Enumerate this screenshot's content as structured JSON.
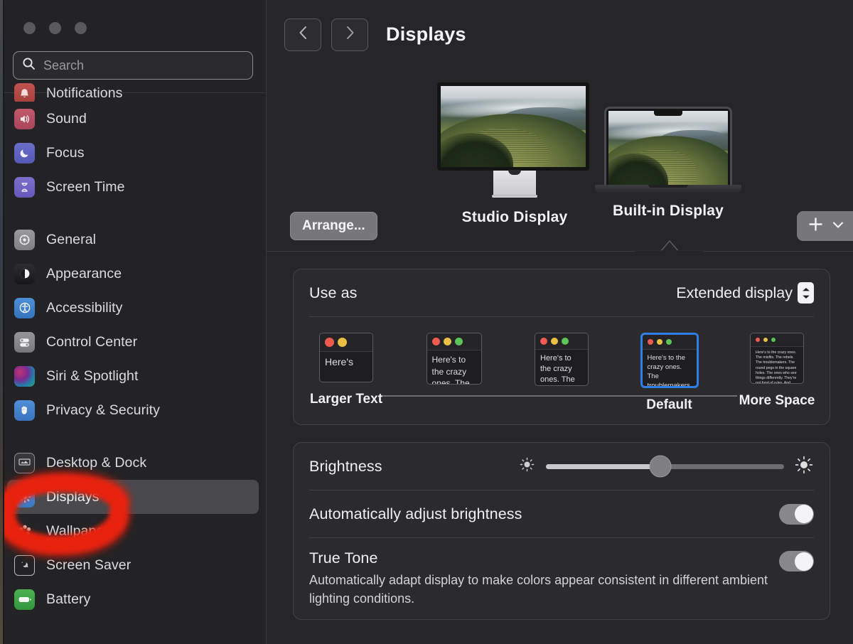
{
  "window": {
    "traffic_lights": [
      "close",
      "minimize",
      "zoom"
    ]
  },
  "search": {
    "placeholder": "Search",
    "value": "",
    "icon": "search-icon"
  },
  "sidebar": {
    "groups": [
      {
        "items": [
          {
            "label": "Notifications",
            "icon": "notifications-icon",
            "clipped": true
          },
          {
            "label": "Sound",
            "icon": "sound-icon"
          },
          {
            "label": "Focus",
            "icon": "focus-icon"
          },
          {
            "label": "Screen Time",
            "icon": "screen-time-icon"
          }
        ]
      },
      {
        "items": [
          {
            "label": "General",
            "icon": "general-icon"
          },
          {
            "label": "Appearance",
            "icon": "appearance-icon"
          },
          {
            "label": "Accessibility",
            "icon": "accessibility-icon"
          },
          {
            "label": "Control Center",
            "icon": "control-center-icon"
          },
          {
            "label": "Siri & Spotlight",
            "icon": "siri-icon"
          },
          {
            "label": "Privacy & Security",
            "icon": "privacy-icon"
          }
        ]
      },
      {
        "items": [
          {
            "label": "Desktop & Dock",
            "icon": "desktop-dock-icon"
          },
          {
            "label": "Displays",
            "icon": "displays-icon",
            "selected": true
          },
          {
            "label": "Wallpaper",
            "icon": "wallpaper-icon"
          },
          {
            "label": "Screen Saver",
            "icon": "screen-saver-icon"
          },
          {
            "label": "Battery",
            "icon": "battery-icon"
          }
        ]
      }
    ]
  },
  "annotation": {
    "shape": "hand-drawn-ellipse",
    "color": "#e02214",
    "targets": "Displays"
  },
  "toolbar": {
    "back_icon": "chevron-left-icon",
    "forward_icon": "chevron-right-icon",
    "title": "Displays"
  },
  "display_picker": {
    "arrange_label": "Arrange...",
    "add_icon": "plus-icon",
    "add_chevron_icon": "chevron-down-icon",
    "displays": [
      {
        "name": "Studio Display",
        "type": "monitor",
        "selected": false
      },
      {
        "name": "Built-in Display",
        "type": "laptop",
        "selected": true
      }
    ]
  },
  "resolution_panel": {
    "use_as_label": "Use as",
    "use_as_value": "Extended display",
    "use_as_stepper_icon": "chevron-up-down-icon",
    "options": [
      {
        "caption": "Larger Text",
        "text": "Here's",
        "selected": false,
        "thumb_w": 76,
        "thumb_h": 70,
        "font_size": 14,
        "dot_size": 13,
        "dots": [
          "r",
          "y"
        ]
      },
      {
        "caption": "",
        "text": "Here's to the crazy ones. The troublemakers.",
        "selected": false,
        "thumb_w": 78,
        "thumb_h": 73,
        "font_size": 12,
        "dot_size": 11,
        "dots": [
          "r",
          "y",
          "g"
        ]
      },
      {
        "caption": "",
        "text": "Here's to the crazy ones. The troublemakers. The round pegs in the ones who see things",
        "selected": false,
        "thumb_w": 76,
        "thumb_h": 75,
        "font_size": 11,
        "dot_size": 10,
        "dots": [
          "r",
          "y",
          "g"
        ]
      },
      {
        "caption": "Default",
        "text": "Here's to the crazy ones. The troublemakers. The round pegs in the ones who see things differently. They're not fond of rules. And they have no respect for the status quo.",
        "selected": true,
        "thumb_w": 82,
        "thumb_h": 78,
        "font_size": 9.5,
        "dot_size": 8,
        "dots": [
          "r",
          "y",
          "g"
        ]
      },
      {
        "caption": "More Space",
        "text": "Here's to the crazy ones. The misfits. The rebels. The troublemakers. The round pegs in the square holes. The ones who see things differently. They're not fond of rules. And they have no respect for the status quo. You can quote them, disagree with them, glorify or vilify them. About the only thing you can't do is ignore them. Because they change things.",
        "selected": false,
        "thumb_w": 76,
        "thumb_h": 72,
        "font_size": 5.2,
        "dot_size": 6,
        "dots": [
          "r",
          "y",
          "g"
        ]
      }
    ]
  },
  "brightness_panel": {
    "brightness_label": "Brightness",
    "brightness_value_percent": 48,
    "low_icon": "sun-low-icon",
    "high_icon": "sun-high-icon",
    "auto_brightness_label": "Automatically adjust brightness",
    "auto_brightness_on": true,
    "true_tone_label": "True Tone",
    "true_tone_desc": "Automatically adapt display to make colors appear consistent in different ambient lighting conditions.",
    "true_tone_on": true
  },
  "colors": {
    "accent_blue": "#2f7fe8",
    "window_bg": "#262628",
    "sidebar_bg": "#232325",
    "panel_bg": "#2b2b2d",
    "annotation_red": "#e02214"
  }
}
